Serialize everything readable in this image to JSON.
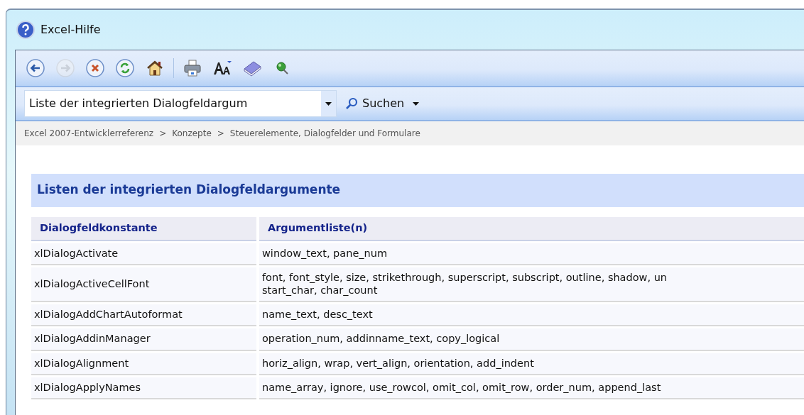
{
  "window": {
    "title": "Excel-Hilfe"
  },
  "toolbar": [
    {
      "kind": "back",
      "disabled": false
    },
    {
      "kind": "forward",
      "disabled": true
    },
    {
      "kind": "stop",
      "disabled": false
    },
    {
      "kind": "refresh",
      "disabled": false
    },
    {
      "kind": "home",
      "disabled": false
    },
    {
      "kind": "separator"
    },
    {
      "kind": "print",
      "disabled": false
    },
    {
      "kind": "textsize",
      "disabled": false
    },
    {
      "kind": "book",
      "disabled": false
    },
    {
      "kind": "pin",
      "disabled": false
    }
  ],
  "search": {
    "value": "Liste der integrierten Dialogfeldargum",
    "button": "Suchen"
  },
  "breadcrumb": [
    {
      "kind": "link",
      "label": "Excel 2007-Entwicklerreferenz"
    },
    {
      "kind": "separator",
      "label": ">"
    },
    {
      "kind": "link",
      "label": "Konzepte"
    },
    {
      "kind": "separator",
      "label": ">"
    },
    {
      "kind": "link",
      "label": "Steuerelemente, Dialogfelder und Formulare"
    }
  ],
  "heading": "Listen der integrierten Dialogfeldargumente",
  "table": {
    "columns": [
      "Dialogfeldkonstante",
      "Argumentliste(n)"
    ],
    "rows": [
      [
        "xlDialogActivate",
        "window_text, pane_num"
      ],
      [
        "xlDialogActiveCellFont",
        "font, font_style, size, strikethrough, superscript, subscript, outline, shadow, un\nstart_char, char_count"
      ],
      [
        "xlDialogAddChartAutoformat",
        "name_text, desc_text"
      ],
      [
        "xlDialogAddinManager",
        "operation_num, addinname_text, copy_logical"
      ],
      [
        "xlDialogAlignment",
        "horiz_align, wrap, vert_align, orientation, add_indent"
      ],
      [
        "xlDialogApplyNames",
        "name_array, ignore, use_rowcol, omit_col, omit_row, order_num, append_last"
      ]
    ]
  }
}
